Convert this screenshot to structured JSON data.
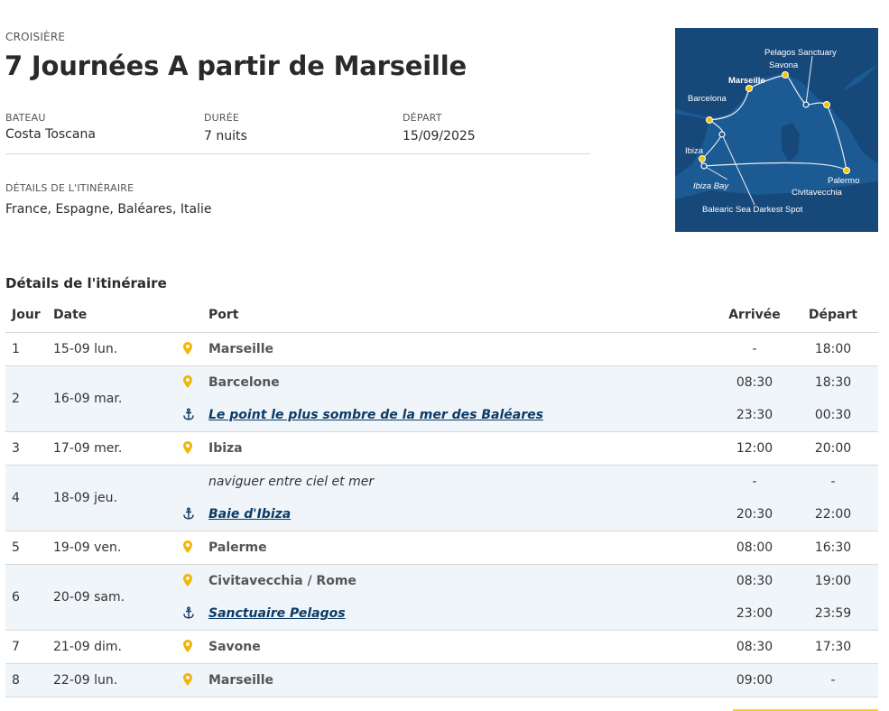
{
  "header": {
    "eyebrow": "CROISIÈRE",
    "title": "7 Journées A partir de Marseille"
  },
  "info": {
    "ship_label": "BATEAU",
    "ship_value": "Costa Toscana",
    "duration_label": "DURÉE",
    "duration_value": "7 nuits",
    "departure_label": "DÉPART",
    "departure_value": "15/09/2025"
  },
  "details": {
    "label": "DÉTAILS DE L'ITINÉRAIRE",
    "value": "France, Espagne, Baléares, Italie"
  },
  "map": {
    "labels": {
      "pelagos": "Pelagos Sanctuary",
      "savona": "Savona",
      "marseille": "Marseille",
      "barcelona": "Barcelona",
      "ibiza": "Ibiza",
      "ibiza_bay": "Ibiza Bay",
      "palermo": "Palermo",
      "civitavecchia": "Civitavecchia",
      "balearic": "Balearic Sea Darkest Spot"
    },
    "sea_color": "#1b5a93",
    "land_color": "#16487a",
    "port_color": "#f5c400"
  },
  "itinerary": {
    "section_title": "Détails de l'itinéraire",
    "headers": {
      "day": "Jour",
      "date": "Date",
      "port": "Port",
      "arrival": "Arrivée",
      "departure": "Départ"
    },
    "rows": [
      {
        "day": "1",
        "date": "15-09 lun.",
        "port": "Marseille",
        "arr": "-",
        "dep": "18:00"
      },
      {
        "day": "2",
        "date": "16-09 mar.",
        "port": "Barcelone",
        "arr": "08:30",
        "dep": "18:30",
        "port2": "Le point le plus sombre de la mer des Baléares",
        "arr2": "23:30",
        "dep2": "00:30"
      },
      {
        "day": "3",
        "date": "17-09 mer.",
        "port": "Ibiza",
        "arr": "12:00",
        "dep": "20:00"
      },
      {
        "day": "4",
        "date": "18-09 jeu.",
        "port": "naviguer entre ciel et mer",
        "arr": "-",
        "dep": "-",
        "port2": "Baie d'Ibiza",
        "arr2": "20:30",
        "dep2": "22:00"
      },
      {
        "day": "5",
        "date": "19-09 ven.",
        "port": "Palerme",
        "arr": "08:00",
        "dep": "16:30"
      },
      {
        "day": "6",
        "date": "20-09 sam.",
        "port": "Civitavecchia / Rome",
        "arr": "08:30",
        "dep": "19:00",
        "port2": "Sanctuaire Pelagos",
        "arr2": "23:00",
        "dep2": "23:59"
      },
      {
        "day": "7",
        "date": "21-09 dim.",
        "port": "Savone",
        "arr": "08:30",
        "dep": "17:30"
      },
      {
        "day": "8",
        "date": "22-09 lun.",
        "port": "Marseille",
        "arr": "09:00",
        "dep": "-"
      }
    ]
  },
  "colors": {
    "pin": "#f2b705",
    "anchor": "#0d3b66",
    "link": "#0d3b66",
    "row_alt": "#f0f5fa",
    "accent_line": "#f7d117"
  }
}
